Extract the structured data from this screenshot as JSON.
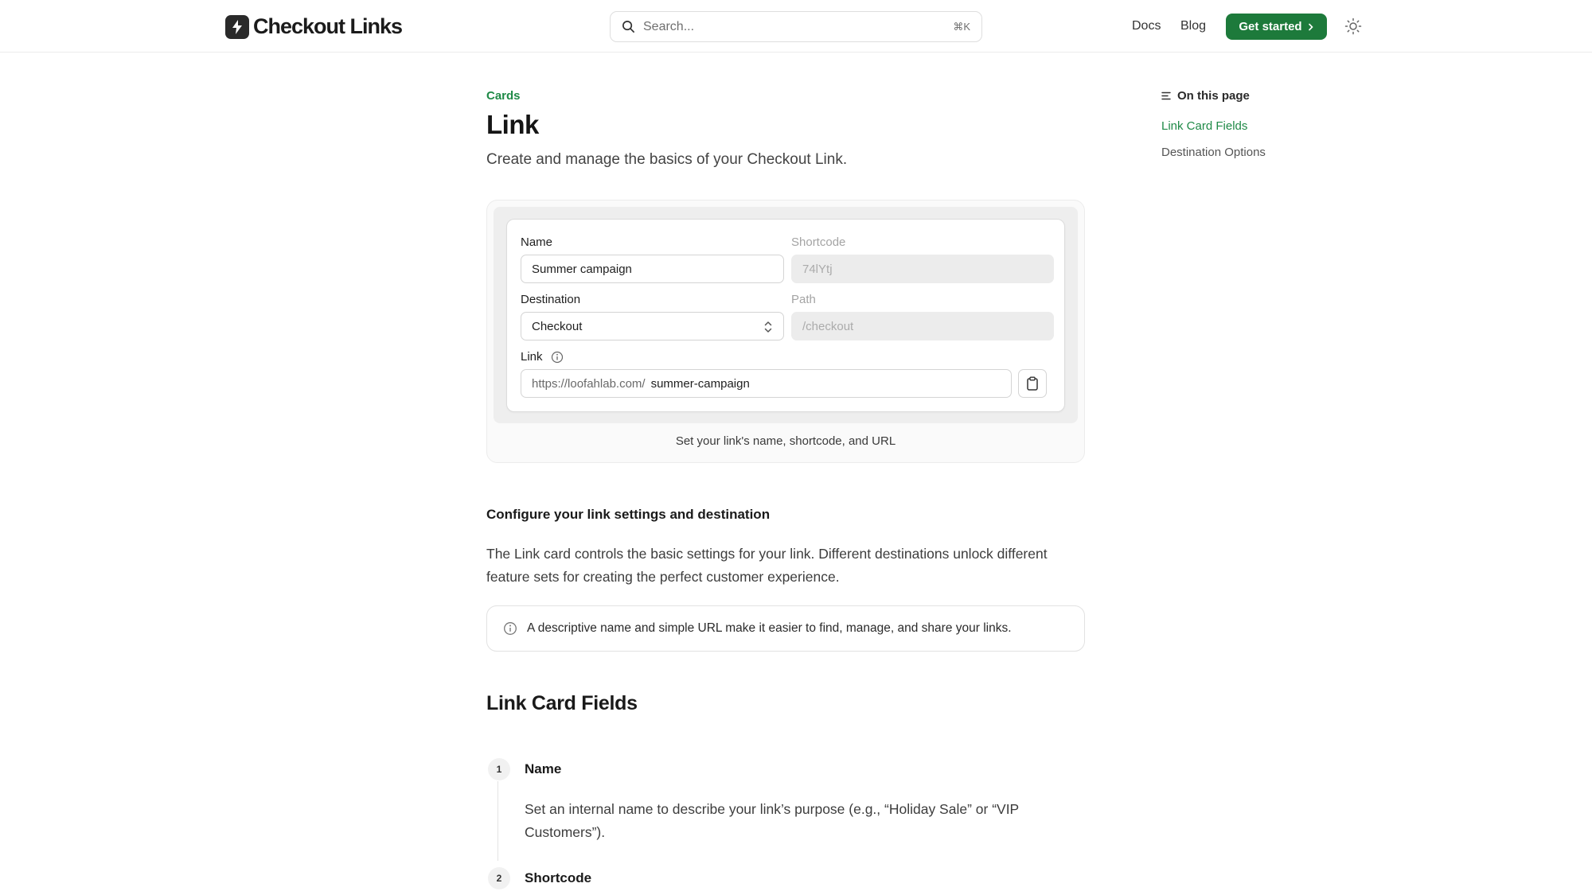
{
  "header": {
    "logo_text": "Checkout Links",
    "search_placeholder": "Search...",
    "search_shortcut": "⌘K",
    "nav": [
      "Docs",
      "Blog"
    ],
    "cta_label": "Get started",
    "theme_icon": "sun-icon"
  },
  "page": {
    "breadcrumb": "Cards",
    "title": "Link",
    "subtitle": "Create and manage the basics of your Checkout Link."
  },
  "preview": {
    "name_label": "Name",
    "name_value": "Summer campaign",
    "shortcode_label": "Shortcode",
    "shortcode_value": "74lYtj",
    "destination_label": "Destination",
    "destination_value": "Checkout",
    "path_label": "Path",
    "path_value": "/checkout",
    "link_label": "Link",
    "link_prefix": "https://loofahlab.com/",
    "link_slug": "summer-campaign",
    "caption": "Set your link's name, shortcode, and URL"
  },
  "content": {
    "section_heading": "Configure your link settings and destination",
    "paragraph": "The Link card controls the basic settings for your link. Different destinations unlock different feature sets for creating the perfect customer experience.",
    "callout": "A descriptive name and simple URL make it easier to find, manage, and share your links.",
    "fields_heading": "Link Card Fields",
    "steps": [
      {
        "num": "1",
        "title": "Name",
        "desc": "Set an internal name to describe your link’s purpose (e.g., “Holiday Sale” or “VIP Customers”)."
      },
      {
        "num": "2",
        "title": "Shortcode",
        "desc": ""
      }
    ]
  },
  "toc": {
    "title": "On this page",
    "items": [
      "Link Card Fields",
      "Destination Options"
    ]
  },
  "colors": {
    "accent": "#1f8a47",
    "cta_bg": "#1d7a3b"
  }
}
